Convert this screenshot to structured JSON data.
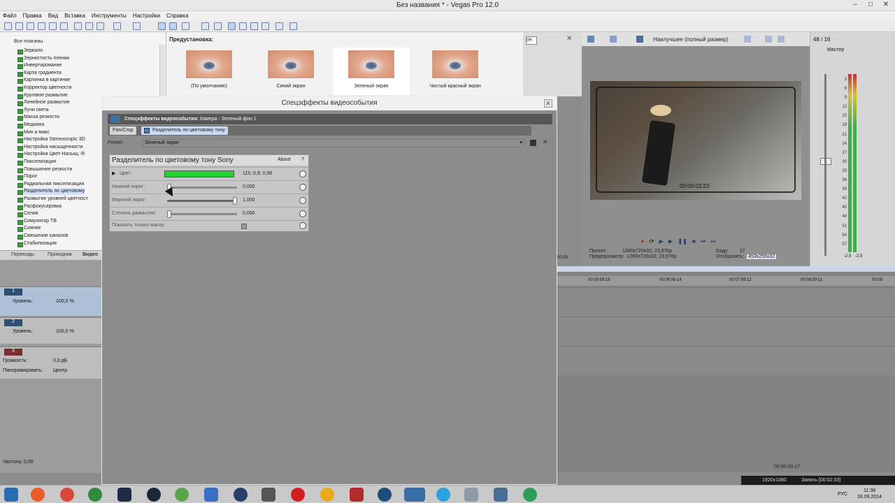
{
  "window": {
    "title": "Без названия * - Vegas Pro 12.0"
  },
  "menu": [
    "Файл",
    "Правка",
    "Вид",
    "Вставка",
    "Инструменты",
    "Настройки",
    "Справка"
  ],
  "fx_tree": {
    "header": "Все плагины",
    "items": [
      "Зеркало",
      "Зернистость пленки",
      "Инвертирование",
      "Карта градиента",
      "Картинка в картинке",
      "Корректор цветности",
      "Круговое размытие",
      "Линейное размытие",
      "Лучи света",
      "Маска резкости",
      "Медиана",
      "Мин и макс",
      "Настройка Stereoscopic 3D",
      "Настройка насыщенности",
      "Настройка Цвет-Насыщ.-Я",
      "Пикселизация",
      "Повышение резкости",
      "Порог",
      "Радиальная пикселизация",
      "Разделитель по цветовому",
      "Размытие уровней цветност",
      "Расфокусировка",
      "Сепия",
      "Симулятор ТВ",
      "Сияние",
      "Смешение каналов",
      "Стабилизация"
    ]
  },
  "left_tabs": [
    "Переходы",
    "Проводник",
    "Видео"
  ],
  "presets": {
    "header": "Предустановка:",
    "items": [
      "(По умолчанию)",
      "Синий экран",
      "Зеленый экран",
      "Чистый красный экран"
    ],
    "selected": 2
  },
  "dialog": {
    "title": "Спецэффекты видеособытия",
    "chain_label": "Спецэффекты видеособытия:",
    "chain_target": "Камера - Зеленый фон 1",
    "chips": [
      "Pan/Crop",
      "Разделитель по цветовому тону"
    ],
    "preset_label": "Preset:",
    "preset_value": "Зеленый экран",
    "plugin": {
      "name": "Разделитель по цветовому тону Sony",
      "about": "About",
      "help": "?",
      "params": [
        {
          "label": "Цвет:",
          "value": "115; 0,9; 0,96",
          "color": "#22d233"
        },
        {
          "label": "Нижний порог:",
          "value": "0,000",
          "level": 0.0
        },
        {
          "label": "Верхний порог:",
          "value": "1,000",
          "level": 1.0
        },
        {
          "label": "Степень размытия:",
          "value": "0,000",
          "level": 0.0
        },
        {
          "label": "Показать только маску:",
          "value": ""
        }
      ]
    }
  },
  "preview": {
    "quality": "Наилучшее (полный размер)",
    "timecode": "00:00:03:23",
    "project_label": "Проект:",
    "project_value": "1280x720x32; 23,976p",
    "preview_label": "Предпросмотр:",
    "preview_value": "1280x720x32; 23,976p",
    "frame_label": "Кадр:",
    "frame_value": "17",
    "display_label": "Отобразить:",
    "display_value": "453x255x32",
    "handle": "(Н"
  },
  "mixer": {
    "rate": "48 / 16",
    "master": "Мастер",
    "scale": [
      "3",
      "6",
      "9",
      "12",
      "15",
      "18",
      "21",
      "24",
      "27",
      "30",
      "33",
      "36",
      "39",
      "42",
      "45",
      "48",
      "51",
      "54",
      "57"
    ],
    "bottom": [
      "-2.5",
      "-2.5"
    ]
  },
  "timeline": {
    "ruler": [
      "00:05:59:15",
      "00:06:59:14",
      "00:07:59:12",
      "00:08:59:11",
      "00:09:"
    ],
    "current": "00:00:00:17",
    "left_tc": "00:00"
  },
  "tracks": [
    {
      "num": "1",
      "level_label": "Уровень:",
      "level": "100,0 %"
    },
    {
      "num": "2",
      "level_label": "Уровень:",
      "level": "100,0 %"
    },
    {
      "num": "3",
      "vol_label": "Громкость:",
      "vol": "0,0 дБ",
      "pan_label": "Панорамировать:",
      "pan": "Центр"
    }
  ],
  "rate_label": "Частота: 0,00",
  "status": {
    "res": "1920x1080",
    "rec": "Запись [00:02:33]"
  },
  "taskbar": {
    "lang": "РУС",
    "time": "11:38",
    "date": "28.09.2014"
  }
}
